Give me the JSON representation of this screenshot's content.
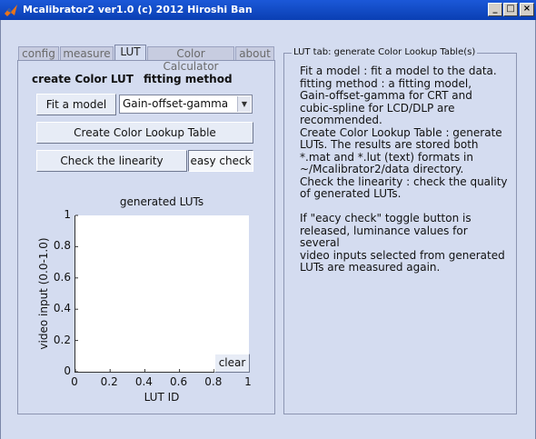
{
  "window": {
    "title": "Mcalibrator2 ver1.0 (c) 2012 Hiroshi Ban",
    "minimize": "_",
    "maximize": "□",
    "close": "×"
  },
  "tabs": [
    {
      "label": "config"
    },
    {
      "label": "measure"
    },
    {
      "label": "LUT"
    },
    {
      "label": "Color Calculator"
    },
    {
      "label": "about"
    }
  ],
  "lut_panel": {
    "create_label": "create Color LUT",
    "fitting_label": "fitting method",
    "fit_button": "Fit a model",
    "fitting_method_value": "Gain-offset-gamma",
    "create_button": "Create Color Lookup Table",
    "check_button": "Check the linearity",
    "easy_check_toggle": "easy check",
    "clear_button": "clear"
  },
  "chart_data": {
    "type": "line",
    "title": "generated LUTs",
    "xlabel": "LUT ID",
    "ylabel": "video input (0.0-1.0)",
    "xlim": [
      0,
      1
    ],
    "ylim": [
      0,
      1
    ],
    "xticks": [
      "0",
      "0.2",
      "0.4",
      "0.6",
      "0.8",
      "1"
    ],
    "yticks": [
      "0",
      "0.2",
      "0.4",
      "0.6",
      "0.8",
      "1"
    ],
    "series": []
  },
  "help": {
    "title": "LUT tab: generate Color Lookup Table(s)",
    "text": "Fit a model : fit a model to the data.\nfitting method : a fitting model,\nGain-offset-gamma for CRT and\ncubic-spline for LCD/DLP are\nrecommended.\nCreate Color Lookup Table : generate\nLUTs. The results are stored both\n*.mat and *.lut (text) formats in\n~/Mcalibrator2/data directory.\nCheck the linearity : check the quality\nof generated LUTs.\n\nIf \"eacy check\" toggle button is\nreleased, luminance values for several\nvideo inputs selected from generated\nLUTs are measured again."
  }
}
